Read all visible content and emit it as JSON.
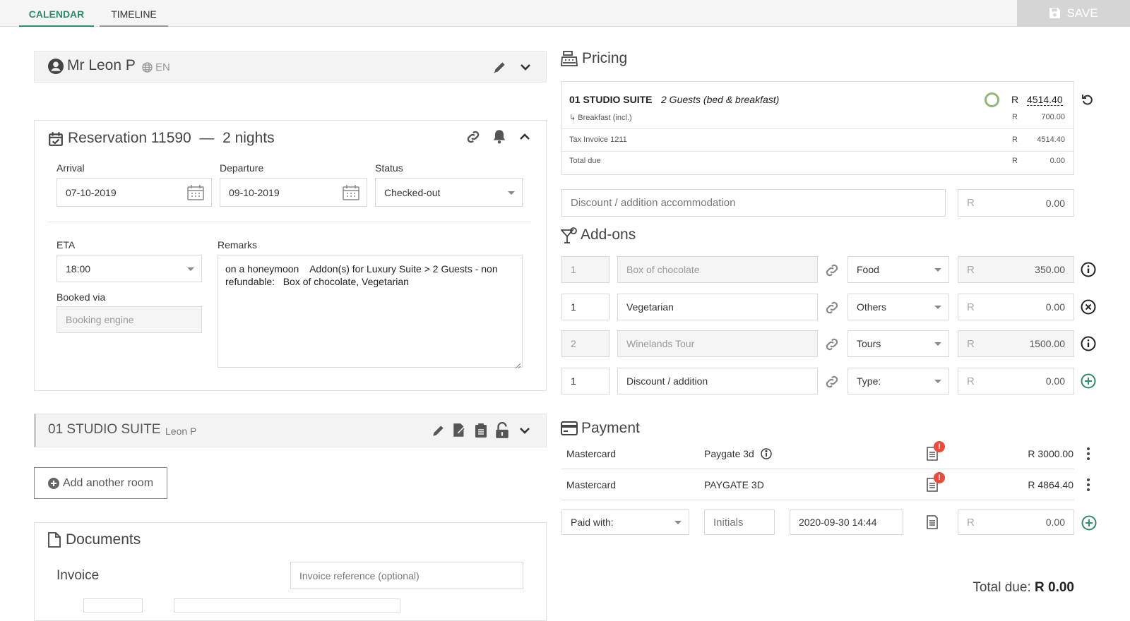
{
  "tabs": [
    {
      "label": "CALENDAR"
    },
    {
      "label": "TIMELINE"
    }
  ],
  "save_label": "SAVE",
  "guest": {
    "name": "Mr Leon P",
    "lang": "EN"
  },
  "reservation": {
    "title": "Reservation 11590",
    "dash": "—",
    "nights": "2 nights",
    "arrival_label": "Arrival",
    "arrival": "07-10-2019",
    "departure_label": "Departure",
    "departure": "09-10-2019",
    "status_label": "Status",
    "status": "Checked-out",
    "eta_label": "ETA",
    "eta": "18:00",
    "remarks_label": "Remarks",
    "remarks": "on a honeymoon    Addon(s) for Luxury Suite > 2 Guests - non refundable:   Box of chocolate, Vegetarian",
    "booked_via_label": "Booked via",
    "booked_via_placeholder": "Booking engine"
  },
  "room": {
    "name": "01 STUDIO SUITE",
    "guest": "Leon P"
  },
  "add_room_label": "Add another room",
  "documents": {
    "title": "Documents",
    "invoice_label": "Invoice",
    "invoice_placeholder": "Invoice reference (optional)"
  },
  "pricing": {
    "title": "Pricing",
    "room": "01 STUDIO SUITE",
    "guests": "2 Guests (bed & breakfast)",
    "currency": "R",
    "room_price": "4514.40",
    "breakfast": "↳ Breakfast  (incl.)",
    "breakfast_price": "700.00",
    "tax_invoice": "Tax Invoice 1211",
    "tax_price": "4514.40",
    "total_due_label": "Total due",
    "total_due": "0.00",
    "discount_placeholder": "Discount / addition accommodation",
    "discount_value": "0.00"
  },
  "addons": {
    "title": "Add-ons",
    "rows": [
      {
        "qty": "1",
        "name": "Box of chocolate",
        "cat": "Food",
        "cur": "R",
        "price": "350.00",
        "action": "info-icon"
      },
      {
        "qty": "1",
        "name": "Vegetarian",
        "cat": "Others",
        "cur": "R",
        "price": "0.00",
        "action": "remove-icon"
      },
      {
        "qty": "2",
        "name": "Winelands Tour",
        "cat": "Tours",
        "cur": "R",
        "price": "1500.00",
        "action": "info-icon"
      },
      {
        "qty": "1",
        "name": "Discount / addition",
        "cat": "Type:",
        "cur": "R",
        "price": "0.00",
        "action": "add-icon"
      }
    ]
  },
  "payment": {
    "title": "Payment",
    "rows": [
      {
        "method": "Mastercard",
        "gateway": "Paygate 3d",
        "amount": "R 3000.00"
      },
      {
        "method": "Mastercard",
        "gateway": "PAYGATE 3D",
        "amount": "R 4864.40"
      }
    ],
    "paid_with": "Paid with:",
    "initials_placeholder": "Initials",
    "datetime": "2020-09-30 14:44",
    "cur": "R",
    "new_amount": "0.00"
  },
  "total_due_label": "Total due:",
  "total_due_value": "R 0.00",
  "colors": {
    "accent": "#2e8b66",
    "alert": "#e74c3c"
  }
}
